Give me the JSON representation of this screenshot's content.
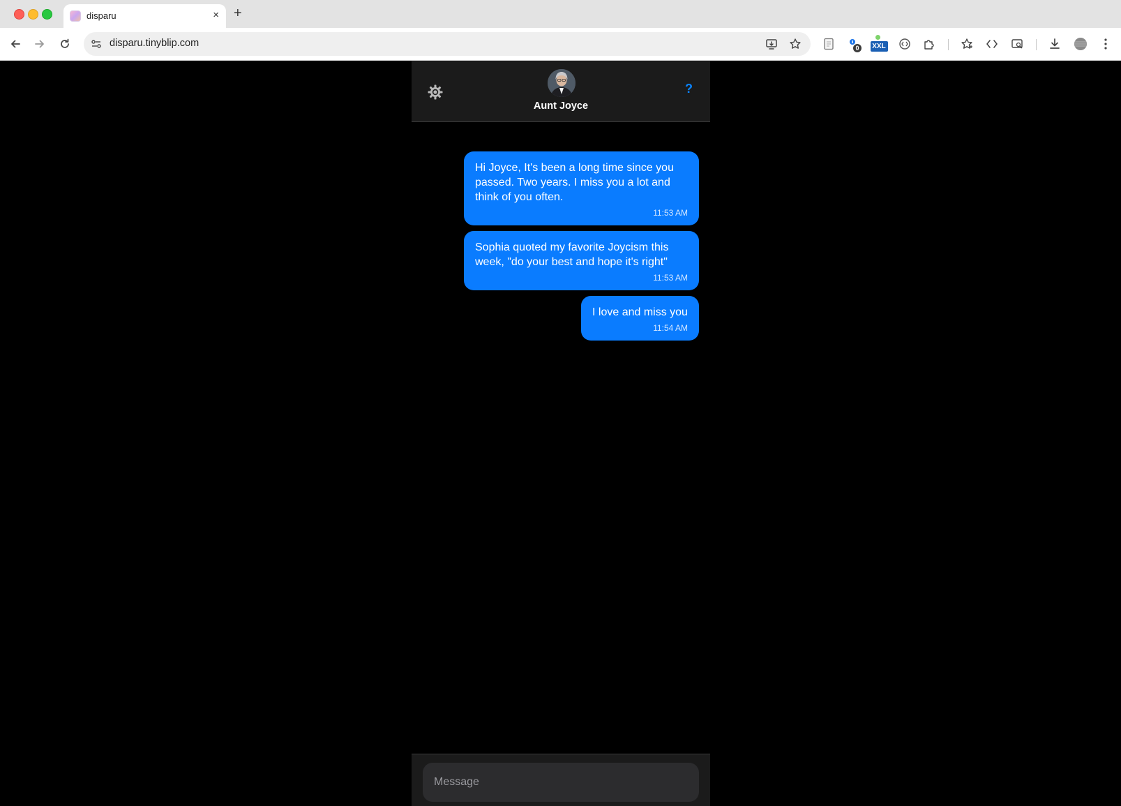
{
  "browser": {
    "tab_title": "disparu",
    "tab_close": "×",
    "new_tab": "+",
    "url": "disparu.tinyblip.com",
    "extension_badge_count": "0",
    "extension_xxl_label": "XXL"
  },
  "header": {
    "contact_name": "Aunt Joyce",
    "help_label": "?"
  },
  "messages": [
    {
      "text": "Hi Joyce, It's been a long time since you passed. Two years. I miss you a lot and think of you often.",
      "time": "11:53 AM"
    },
    {
      "text": "Sophia quoted my favorite Joycism this week, \"do your best and hope it's right\"",
      "time": "11:53 AM"
    },
    {
      "text": "I love and miss you",
      "time": "11:54 AM"
    }
  ],
  "composer": {
    "placeholder": "Message"
  },
  "colors": {
    "bubble": "#0a7cff",
    "accent": "#0a84ff",
    "panel": "#1b1b1b",
    "background": "#000000"
  }
}
